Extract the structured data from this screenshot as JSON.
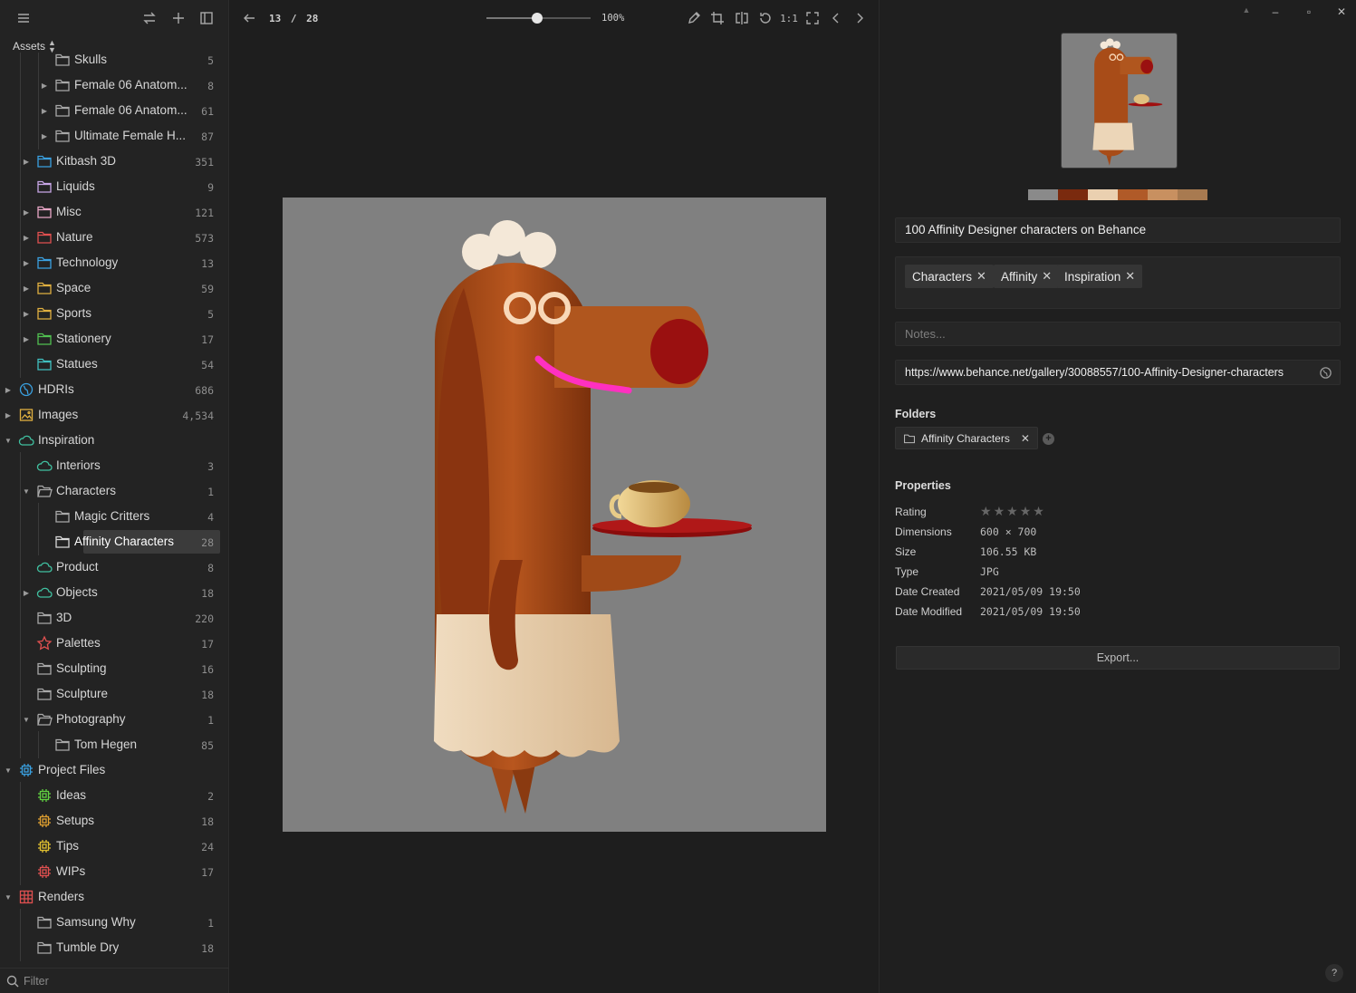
{
  "sidebar": {
    "assets_label": "Assets",
    "filter_placeholder": "Filter",
    "items": [
      {
        "label": "Skulls",
        "count": "5",
        "level": 2,
        "icon": "folder",
        "color": "#a8a8a8",
        "caret": "none"
      },
      {
        "label": "Female 06 Anatom...",
        "count": "8",
        "level": 2,
        "icon": "folder",
        "color": "#a8a8a8",
        "caret": "right"
      },
      {
        "label": "Female 06 Anatom...",
        "count": "61",
        "level": 2,
        "icon": "folder",
        "color": "#a8a8a8",
        "caret": "right"
      },
      {
        "label": "Ultimate Female H...",
        "count": "87",
        "level": 2,
        "icon": "folder",
        "color": "#a8a8a8",
        "caret": "right"
      },
      {
        "label": "Kitbash 3D",
        "count": "351",
        "level": 1,
        "icon": "folder",
        "color": "#3aa0e0",
        "caret": "right"
      },
      {
        "label": "Liquids",
        "count": "9",
        "level": 1,
        "icon": "folder",
        "color": "#c8a6e6",
        "caret": "none"
      },
      {
        "label": "Misc",
        "count": "121",
        "level": 1,
        "icon": "folder",
        "color": "#e8a6c6",
        "caret": "right"
      },
      {
        "label": "Nature",
        "count": "573",
        "level": 1,
        "icon": "folder",
        "color": "#e05050",
        "caret": "right"
      },
      {
        "label": "Technology",
        "count": "13",
        "level": 1,
        "icon": "folder",
        "color": "#3aa0e0",
        "caret": "right"
      },
      {
        "label": "Space",
        "count": "59",
        "level": 1,
        "icon": "folder",
        "color": "#e0b040",
        "caret": "right"
      },
      {
        "label": "Sports",
        "count": "5",
        "level": 1,
        "icon": "folder",
        "color": "#e0b040",
        "caret": "right"
      },
      {
        "label": "Stationery",
        "count": "17",
        "level": 1,
        "icon": "folder",
        "color": "#50c050",
        "caret": "right"
      },
      {
        "label": "Statues",
        "count": "54",
        "level": 1,
        "icon": "folder",
        "color": "#40c0c0",
        "caret": "none"
      },
      {
        "label": "HDRIs",
        "count": "686",
        "level": 0,
        "icon": "globe",
        "color": "#3aa0e0",
        "caret": "right"
      },
      {
        "label": "Images",
        "count": "4,534",
        "level": 0,
        "icon": "image",
        "color": "#e0b040",
        "caret": "right"
      },
      {
        "label": "Inspiration",
        "count": "",
        "level": 0,
        "icon": "cloud",
        "color": "#40c0a0",
        "caret": "down"
      },
      {
        "label": "Interiors",
        "count": "3",
        "level": 1,
        "icon": "cloud",
        "color": "#40c0a0",
        "caret": "none"
      },
      {
        "label": "Characters",
        "count": "1",
        "level": 1,
        "icon": "folder-open",
        "color": "#a8a8a8",
        "caret": "down"
      },
      {
        "label": "Magic Critters",
        "count": "4",
        "level": 2,
        "icon": "folder",
        "color": "#a8a8a8",
        "caret": "none"
      },
      {
        "label": "Affinity Characters",
        "count": "28",
        "level": 2,
        "icon": "folder",
        "color": "#d8d8d8",
        "caret": "none",
        "selected": true
      },
      {
        "label": "Product",
        "count": "8",
        "level": 1,
        "icon": "cloud",
        "color": "#40c0a0",
        "caret": "none"
      },
      {
        "label": "Objects",
        "count": "18",
        "level": 1,
        "icon": "cloud",
        "color": "#40c0a0",
        "caret": "right"
      },
      {
        "label": "3D",
        "count": "220",
        "level": 1,
        "icon": "folder",
        "color": "#a8a8a8",
        "caret": "none"
      },
      {
        "label": "Palettes",
        "count": "17",
        "level": 1,
        "icon": "star",
        "color": "#e05050",
        "caret": "none"
      },
      {
        "label": "Sculpting",
        "count": "16",
        "level": 1,
        "icon": "folder",
        "color": "#a8a8a8",
        "caret": "none"
      },
      {
        "label": "Sculpture",
        "count": "18",
        "level": 1,
        "icon": "folder",
        "color": "#a8a8a8",
        "caret": "none"
      },
      {
        "label": "Photography",
        "count": "1",
        "level": 1,
        "icon": "folder-open",
        "color": "#a8a8a8",
        "caret": "down"
      },
      {
        "label": "Tom Hegen",
        "count": "85",
        "level": 2,
        "icon": "folder",
        "color": "#a8a8a8",
        "caret": "none"
      },
      {
        "label": "Project Files",
        "count": "",
        "level": 0,
        "icon": "chip",
        "color": "#3aa0e0",
        "caret": "down"
      },
      {
        "label": "Ideas",
        "count": "2",
        "level": 1,
        "icon": "chip",
        "color": "#60d040",
        "caret": "none"
      },
      {
        "label": "Setups",
        "count": "18",
        "level": 1,
        "icon": "chip",
        "color": "#e0a030",
        "caret": "none"
      },
      {
        "label": "Tips",
        "count": "24",
        "level": 1,
        "icon": "chip",
        "color": "#e0c030",
        "caret": "none"
      },
      {
        "label": "WIPs",
        "count": "17",
        "level": 1,
        "icon": "chip",
        "color": "#e05050",
        "caret": "none"
      },
      {
        "label": "Renders",
        "count": "",
        "level": 0,
        "icon": "grid",
        "color": "#e05050",
        "caret": "down"
      },
      {
        "label": "Samsung Why",
        "count": "1",
        "level": 1,
        "icon": "folder",
        "color": "#a8a8a8",
        "caret": "none"
      },
      {
        "label": "Tumble Dry",
        "count": "18",
        "level": 1,
        "icon": "folder",
        "color": "#a8a8a8",
        "caret": "none"
      }
    ]
  },
  "viewer": {
    "current": "13",
    "separator": "/",
    "total": "28",
    "zoom": "100%",
    "zoom_slider_fraction": 0.49
  },
  "inspector": {
    "palette": [
      "#8a8a8a",
      "#7a2a0e",
      "#ead0b0",
      "#b05a28",
      "#c89060",
      "#a87a50"
    ],
    "title": "100 Affinity Designer characters on Behance",
    "tags": [
      "Characters",
      "Affinity",
      "Inspiration"
    ],
    "notes_placeholder": "Notes...",
    "url": "https://www.behance.net/gallery/30088557/100-Affinity-Designer-characters",
    "folders_title": "Folders",
    "folder_chip": "Affinity Characters",
    "properties_title": "Properties",
    "properties": [
      {
        "label": "Rating",
        "value": ""
      },
      {
        "label": "Dimensions",
        "value": "600 × 700"
      },
      {
        "label": "Size",
        "value": "106.55 KB"
      },
      {
        "label": "Type",
        "value": "JPG"
      },
      {
        "label": "Date Created",
        "value": "2021/05/09 19:50"
      },
      {
        "label": "Date Modified",
        "value": "2021/05/09 19:50"
      }
    ],
    "rating": 0,
    "export_label": "Export...",
    "help_label": "?"
  }
}
